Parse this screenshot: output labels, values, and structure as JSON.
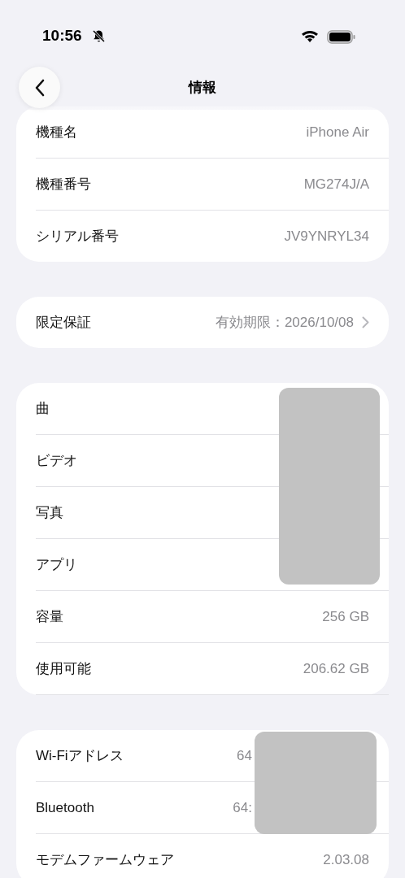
{
  "status_bar": {
    "time": "10:56",
    "silent": true
  },
  "nav": {
    "title": "情報"
  },
  "cards": [
    {
      "rows": [
        {
          "label": "機種名",
          "value": "iPhone Air",
          "chevron": false,
          "masked": false
        },
        {
          "label": "機種番号",
          "value": "MG274J/A",
          "chevron": false,
          "masked": false
        },
        {
          "label": "シリアル番号",
          "value": "JV9YNRYL34",
          "chevron": false,
          "masked": false
        }
      ]
    },
    {
      "rows": [
        {
          "label": "限定保証",
          "value": "有効期限：2026/10/08",
          "chevron": true,
          "masked": false
        }
      ]
    },
    {
      "rows": [
        {
          "label": "曲",
          "chevron": false,
          "masked": true
        },
        {
          "label": "ビデオ",
          "chevron": false,
          "masked": true
        },
        {
          "label": "写真",
          "chevron": false,
          "masked": true
        },
        {
          "label": "アプリ",
          "chevron": false,
          "masked": true
        },
        {
          "label": "容量",
          "value": "256 GB",
          "chevron": false,
          "masked": false
        },
        {
          "label": "使用可能",
          "value": "206.62 GB",
          "chevron": false,
          "masked": false
        }
      ]
    },
    {
      "rows": [
        {
          "label": "Wi-Fiアドレス",
          "value": "64",
          "chevron": false,
          "masked": true
        },
        {
          "label": "Bluetooth",
          "value": "64:",
          "chevron": false,
          "masked": true
        },
        {
          "label": "モデムファームウェア",
          "value": "2.03.08",
          "chevron": false,
          "masked": false
        }
      ]
    }
  ]
}
